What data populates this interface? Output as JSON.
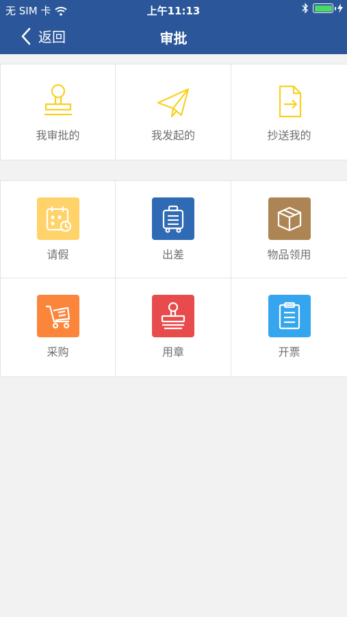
{
  "status_bar": {
    "carrier": "无 SIM 卡",
    "time": "上午11:13",
    "bluetooth_icon": "bluetooth-icon",
    "battery_color": "#4cd964"
  },
  "navbar": {
    "back_label": "返回",
    "title": "审批",
    "background": "#2b579a"
  },
  "top_section": {
    "items": [
      {
        "label": "我审批的",
        "icon": "stamp-outline-icon"
      },
      {
        "label": "我发起的",
        "icon": "paper-plane-icon"
      },
      {
        "label": "抄送我的",
        "icon": "document-forward-icon"
      }
    ],
    "icon_color": "#f8d120"
  },
  "apps": {
    "items": [
      {
        "label": "请假",
        "icon": "calendar-clock-icon",
        "color": "#ffd36a"
      },
      {
        "label": "出差",
        "icon": "luggage-icon",
        "color": "#2f6ab4"
      },
      {
        "label": "物品领用",
        "icon": "box-icon",
        "color": "#ad8555"
      },
      {
        "label": "采购",
        "icon": "cart-icon",
        "color": "#fb853b"
      },
      {
        "label": "用章",
        "icon": "stamp-icon",
        "color": "#e84b4b"
      },
      {
        "label": "开票",
        "icon": "clipboard-icon",
        "color": "#35a6ee"
      }
    ]
  }
}
